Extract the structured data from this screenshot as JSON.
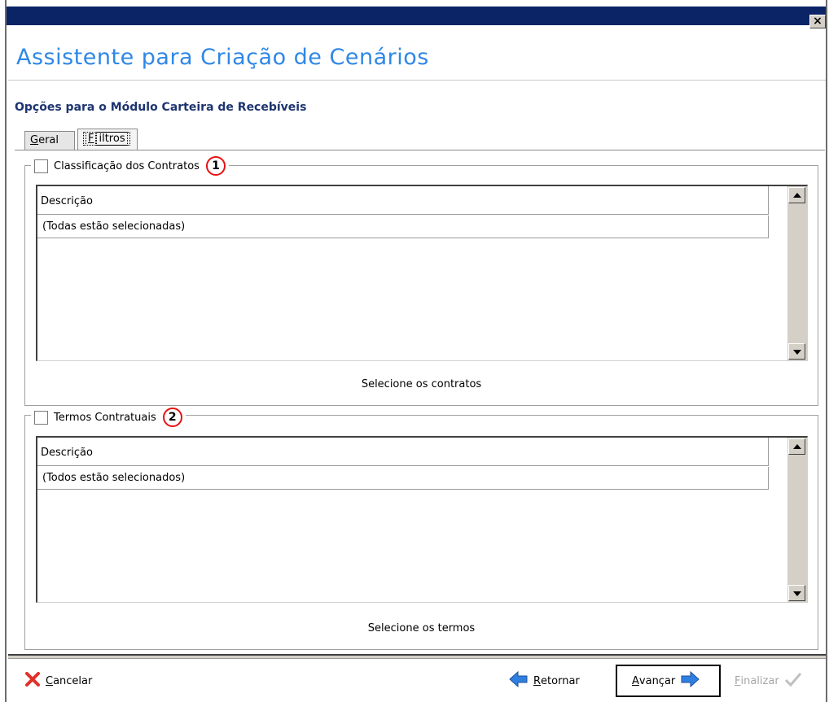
{
  "window": {
    "close_label": "×",
    "title": "Assistente para Criação de Cenários"
  },
  "page": {
    "subtitle": "Opções para o Módulo Carteira de Recebíveis"
  },
  "tabs": [
    {
      "label_first": "G",
      "label_rest": "eral",
      "active": false
    },
    {
      "label_first": "F",
      "label_rest": "iltros",
      "active": true
    }
  ],
  "groups": [
    {
      "title": "Classificação dos Contratos",
      "marker": "1",
      "column_header": "Descrição",
      "rows": [
        "(Todas estão selecionadas)"
      ],
      "hint": "Selecione os contratos"
    },
    {
      "title": "Termos Contratuais",
      "marker": "2",
      "column_header": "Descrição",
      "rows": [
        "(Todos estão selecionados)"
      ],
      "hint": "Selecione os termos"
    }
  ],
  "footer": {
    "cancel_first": "C",
    "cancel_rest": "ancelar",
    "back_first": "R",
    "back_rest": "etornar",
    "next_first": "A",
    "next_rest": "vançar",
    "finish_first": "F",
    "finish_rest": "inalizar"
  },
  "colors": {
    "titlebar": "#0b2465",
    "title_text": "#2f87e6",
    "subtitle_text": "#1d3470",
    "marker_ring": "#e81010",
    "cancel_icon": "#e0302a",
    "arrow_icon": "#2f7fe0"
  }
}
